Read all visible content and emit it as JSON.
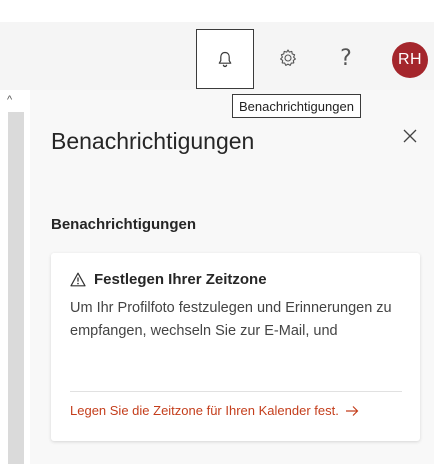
{
  "header": {
    "notifications_icon": "bell-icon",
    "settings_icon": "gear-icon",
    "help_label": "?",
    "avatar_initials": "RH",
    "avatar_color": "#a4262c"
  },
  "tooltip": {
    "text": "Benachrichtigungen"
  },
  "panel": {
    "title": "Benachrichtigungen",
    "close_icon": "close-icon",
    "section_title": "Benachrichtigungen",
    "card": {
      "warning_icon": "warning-icon",
      "title": "Festlegen Ihrer Zeitzone",
      "body": "Um Ihr Profilfoto festzulegen und Erinnerungen zu empfangen, wechseln Sie zur E-Mail, und",
      "link_text": "Legen Sie die Zeitzone für Ihren Kalender fest.",
      "link_icon": "arrow-right-icon",
      "link_color": "#c43e1c"
    }
  }
}
